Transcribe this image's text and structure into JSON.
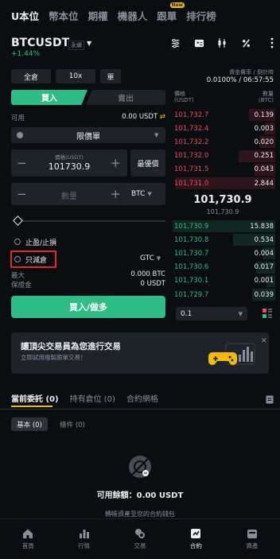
{
  "nav": {
    "tabs": [
      "U本位",
      "幣本位",
      "期權",
      "機器人",
      "跟單",
      "排行榜"
    ],
    "active_index": 0,
    "new_badge": "New"
  },
  "symbol": {
    "name": "BTCUSDT",
    "type": "永續",
    "change": "+1.44%"
  },
  "funding": {
    "label": "資金費率 / 倒計時",
    "value": "0.0100% / 06:57:55"
  },
  "margin": {
    "mode": "全倉",
    "leverage": "10x",
    "extra": "單"
  },
  "trade": {
    "buy_tab": "買入",
    "sell_tab": "賣出",
    "available_label": "可用",
    "available_value": "0.00 USDT",
    "order_type": "限價單",
    "price_label": "價格(USDT)",
    "price_value": "101730.9",
    "bbo_label": "最優價",
    "qty_placeholder": "數量",
    "qty_unit": "BTC",
    "tpsl_label": "止盈/止損",
    "reduce_only_label": "只減倉",
    "tif": "GTC",
    "max_label": "最大",
    "max_value": "0.000 BTC",
    "margin_label": "保證金",
    "margin_value": "0 USDT",
    "submit_label": "買入/做多"
  },
  "orderbook": {
    "price_header": "價格",
    "price_unit": "(USDT)",
    "qty_header": "數量",
    "qty_unit": "(BTC)",
    "asks": [
      {
        "price": "101,732.7",
        "qty": "0.139"
      },
      {
        "price": "101,732.4",
        "qty": "0.003"
      },
      {
        "price": "101,732.2",
        "qty": "0.020"
      },
      {
        "price": "101,732.0",
        "qty": "0.251"
      },
      {
        "price": "101,731.5",
        "qty": "0.043"
      },
      {
        "price": "101,731.0",
        "qty": "2.844"
      }
    ],
    "last_price": "101,730.9",
    "mark_price": "101,730.9",
    "bids": [
      {
        "price": "101,730.9",
        "qty": "15.838"
      },
      {
        "price": "101,730.8",
        "qty": "0.534"
      },
      {
        "price": "101,730.7",
        "qty": "0.004"
      },
      {
        "price": "101,730.6",
        "qty": "0.017"
      },
      {
        "price": "101,730.1",
        "qty": "0.001"
      },
      {
        "price": "101,729.7",
        "qty": "0.039"
      }
    ],
    "depth_step": "0.1"
  },
  "banner": {
    "title": "讓頂尖交易員為您進行交易",
    "subtitle": "立即試用複製跟單交易！"
  },
  "orders": {
    "tabs": [
      "當前委託 (0)",
      "持有倉位 (0)",
      "合約網格"
    ],
    "chips": [
      "基本 (0)",
      "條件 (0)"
    ],
    "available": "可用餘額：0.00 USDT",
    "hint": "轉帳資產至您的合約錢包"
  },
  "bottom_nav": [
    "首頁",
    "行情",
    "交易",
    "合約",
    "資產"
  ],
  "colors": {
    "buy": "#2ebd85",
    "sell": "#f6465d",
    "accent": "#f0b90b",
    "highlight_box": "#e02a2a"
  }
}
